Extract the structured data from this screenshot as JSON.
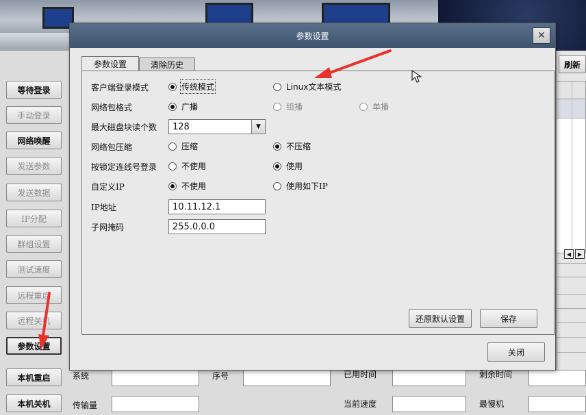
{
  "background_app": {
    "side_buttons": [
      {
        "label": "等待登录",
        "state": "normal"
      },
      {
        "label": "手动登录",
        "state": "disabled"
      },
      {
        "label": "网络唤醒",
        "state": "normal"
      },
      {
        "label": "发送参数",
        "state": "disabled"
      },
      {
        "label": "发送数据",
        "state": "disabled"
      },
      {
        "label": "IP分配",
        "state": "disabled"
      },
      {
        "label": "群组设置",
        "state": "disabled"
      },
      {
        "label": "测试速度",
        "state": "disabled"
      },
      {
        "label": "远程重启",
        "state": "disabled"
      },
      {
        "label": "远程关机",
        "state": "disabled"
      },
      {
        "label": "参数设置",
        "state": "active"
      },
      {
        "label": "本机重启",
        "state": "normal"
      },
      {
        "label": "本机关机",
        "state": "normal"
      }
    ],
    "refresh_label": "刷新",
    "bottom": {
      "system_label": "系统",
      "seq_label": "序号",
      "used_time_label": "已用时间",
      "remaining_time_label": "剩余时间",
      "transfer_label": "传输量",
      "current_speed_label": "当前速度",
      "slowest_label": "最慢机"
    }
  },
  "dialog": {
    "title": "参数设置",
    "close_glyph": "✕",
    "tabs": [
      {
        "label": "参数设置",
        "active": true
      },
      {
        "label": "清除历史",
        "active": false
      }
    ],
    "fields": {
      "login_mode": {
        "label": "客户端登录模式",
        "options": [
          {
            "label": "传统模式",
            "checked": true
          },
          {
            "label": "Linux文本模式",
            "checked": false
          }
        ]
      },
      "packet_format": {
        "label": "网络包格式",
        "options": [
          {
            "label": "广播",
            "checked": true
          },
          {
            "label": "组播",
            "checked": false
          },
          {
            "label": "单播",
            "checked": false
          }
        ]
      },
      "max_disk_blocks": {
        "label": "最大磁盘块读个数",
        "value": "128"
      },
      "compression": {
        "label": "网络包压缩",
        "options": [
          {
            "label": "压缩",
            "checked": false
          },
          {
            "label": "不压缩",
            "checked": true
          }
        ]
      },
      "lock_seq_login": {
        "label": "按锁定连线号登录",
        "options": [
          {
            "label": "不使用",
            "checked": false
          },
          {
            "label": "使用",
            "checked": true
          }
        ]
      },
      "custom_ip": {
        "label": "自定义IP",
        "options": [
          {
            "label": "不使用",
            "checked": true
          },
          {
            "label": "使用如下IP",
            "checked": false
          }
        ]
      },
      "ip_address": {
        "label": "IP地址",
        "value": "10.11.12.1"
      },
      "subnet_mask": {
        "label": "子网掩码",
        "value": "255.0.0.0"
      }
    },
    "buttons": {
      "restore_defaults": "还原默认设置",
      "save": "保存",
      "close": "关闭"
    }
  },
  "colors": {
    "titlebar": "#4a5f7a",
    "annotation_arrow": "#e8322b"
  }
}
